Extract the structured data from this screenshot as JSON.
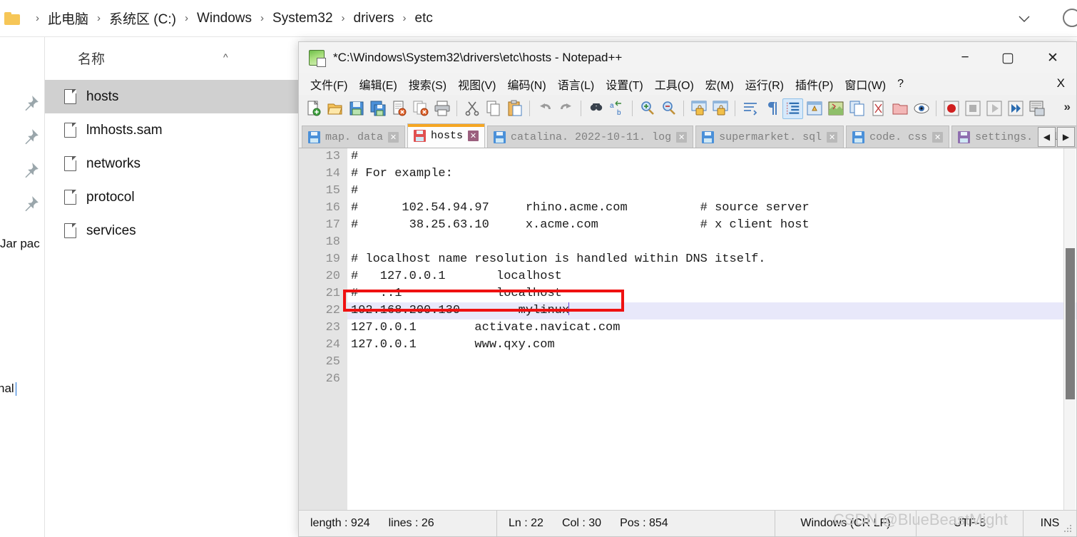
{
  "explorer": {
    "breadcrumb": {
      "folder_icon": "folder-icon",
      "items": [
        "此电脑",
        "系统区 (C:)",
        "Windows",
        "System32",
        "drivers",
        "etc"
      ],
      "separator": "›",
      "chevron_icon": "chevron-down-icon",
      "search_icon": "search-icon"
    },
    "column_header": {
      "name": "名称",
      "sort_caret": "^"
    },
    "files": [
      {
        "name": "hosts",
        "selected": true
      },
      {
        "name": "lmhosts.sam",
        "selected": false
      },
      {
        "name": "networks",
        "selected": false
      },
      {
        "name": "protocol",
        "selected": false
      },
      {
        "name": "services",
        "selected": false
      }
    ],
    "pins": [
      "pin-icon",
      "pin-icon",
      "pin-icon",
      "pin-icon"
    ],
    "background_text": {
      "a": "Jar pac",
      "b": "nal"
    }
  },
  "notepadpp": {
    "title": "*C:\\Windows\\System32\\drivers\\etc\\hosts - Notepad++",
    "app_icon": "notepadpp-icon",
    "window_buttons": {
      "minimize": "−",
      "maximize": "▢",
      "close": "✕"
    },
    "menu": [
      "文件(F)",
      "编辑(E)",
      "搜索(S)",
      "视图(V)",
      "编码(N)",
      "语言(L)",
      "设置(T)",
      "工具(O)",
      "宏(M)",
      "运行(R)",
      "插件(P)",
      "窗口(W)",
      "?"
    ],
    "menu_close": "X",
    "toolbar_more": "»",
    "toolbar_icons": [
      "new-file-icon",
      "open-folder-icon",
      "save-icon",
      "save-all-icon",
      "close-file-icon",
      "close-all-icon",
      "print-icon",
      "cut-icon",
      "copy-icon",
      "paste-icon",
      "undo-icon",
      "redo-icon",
      "find-icon",
      "replace-icon",
      "zoom-in-icon",
      "zoom-out-icon",
      "sync-vertical-scroll-icon",
      "sync-horizontal-scroll-icon",
      "word-wrap-icon",
      "show-all-characters-icon",
      "indent-guide-icon",
      "user-defined-language-icon",
      "document-map-icon",
      "function-list-icon",
      "folder-as-workspace-icon",
      "monitoring-icon",
      "preview-icon",
      "record-macro-icon",
      "stop-macro-icon",
      "play-macro-icon",
      "run-macro-multiple-icon",
      "run-icon"
    ],
    "tabs": [
      {
        "label": "map. data",
        "icon": "save-blue-icon",
        "close": "✕",
        "active": false
      },
      {
        "label": "hosts",
        "icon": "save-red-icon",
        "close": "✕",
        "active": true
      },
      {
        "label": "catalina. 2022-10-11. log",
        "icon": "save-blue-icon",
        "close": "✕",
        "active": false
      },
      {
        "label": "supermarket. sql",
        "icon": "save-blue-icon",
        "close": "✕",
        "active": false
      },
      {
        "label": "code. css",
        "icon": "save-blue-icon",
        "close": "✕",
        "active": false
      },
      {
        "label": "settings. xml",
        "icon": "save-purple-icon",
        "close": "✕",
        "active": false
      }
    ],
    "tab_scroll_left": "◀",
    "tab_scroll_right": "▶",
    "editor": {
      "first_line_number": 13,
      "lines": [
        {
          "n": 13,
          "text": "#"
        },
        {
          "n": 14,
          "text": "# For example:"
        },
        {
          "n": 15,
          "text": "#"
        },
        {
          "n": 16,
          "text": "#      102.54.94.97     rhino.acme.com          # source server"
        },
        {
          "n": 17,
          "text": "#       38.25.63.10     x.acme.com              # x client host"
        },
        {
          "n": 18,
          "text": ""
        },
        {
          "n": 19,
          "text": "# localhost name resolution is handled within DNS itself."
        },
        {
          "n": 20,
          "text": "#   127.0.0.1       localhost"
        },
        {
          "n": 21,
          "text": "#   ::1             localhost"
        },
        {
          "n": 22,
          "text": "192.168.200.130        mylinux",
          "current": true,
          "highlighted": true
        },
        {
          "n": 23,
          "text": "127.0.0.1        activate.navicat.com"
        },
        {
          "n": 24,
          "text": "127.0.0.1        www.qxy.com"
        },
        {
          "n": 25,
          "text": ""
        },
        {
          "n": 26,
          "text": ""
        }
      ],
      "highlight_color": "#ef1111",
      "current_line_color": "#e8e8fa"
    },
    "status": {
      "length_label": "length : 924",
      "lines_label": "lines : 26",
      "ln": "Ln : 22",
      "col": "Col : 30",
      "pos": "Pos : 854",
      "eol": "Windows (CR LF)",
      "encoding": "UTF-8",
      "mode": "INS",
      "grip_icon": "resize-grip-icon"
    }
  },
  "watermark": "CSDN @BlueBeastMight"
}
